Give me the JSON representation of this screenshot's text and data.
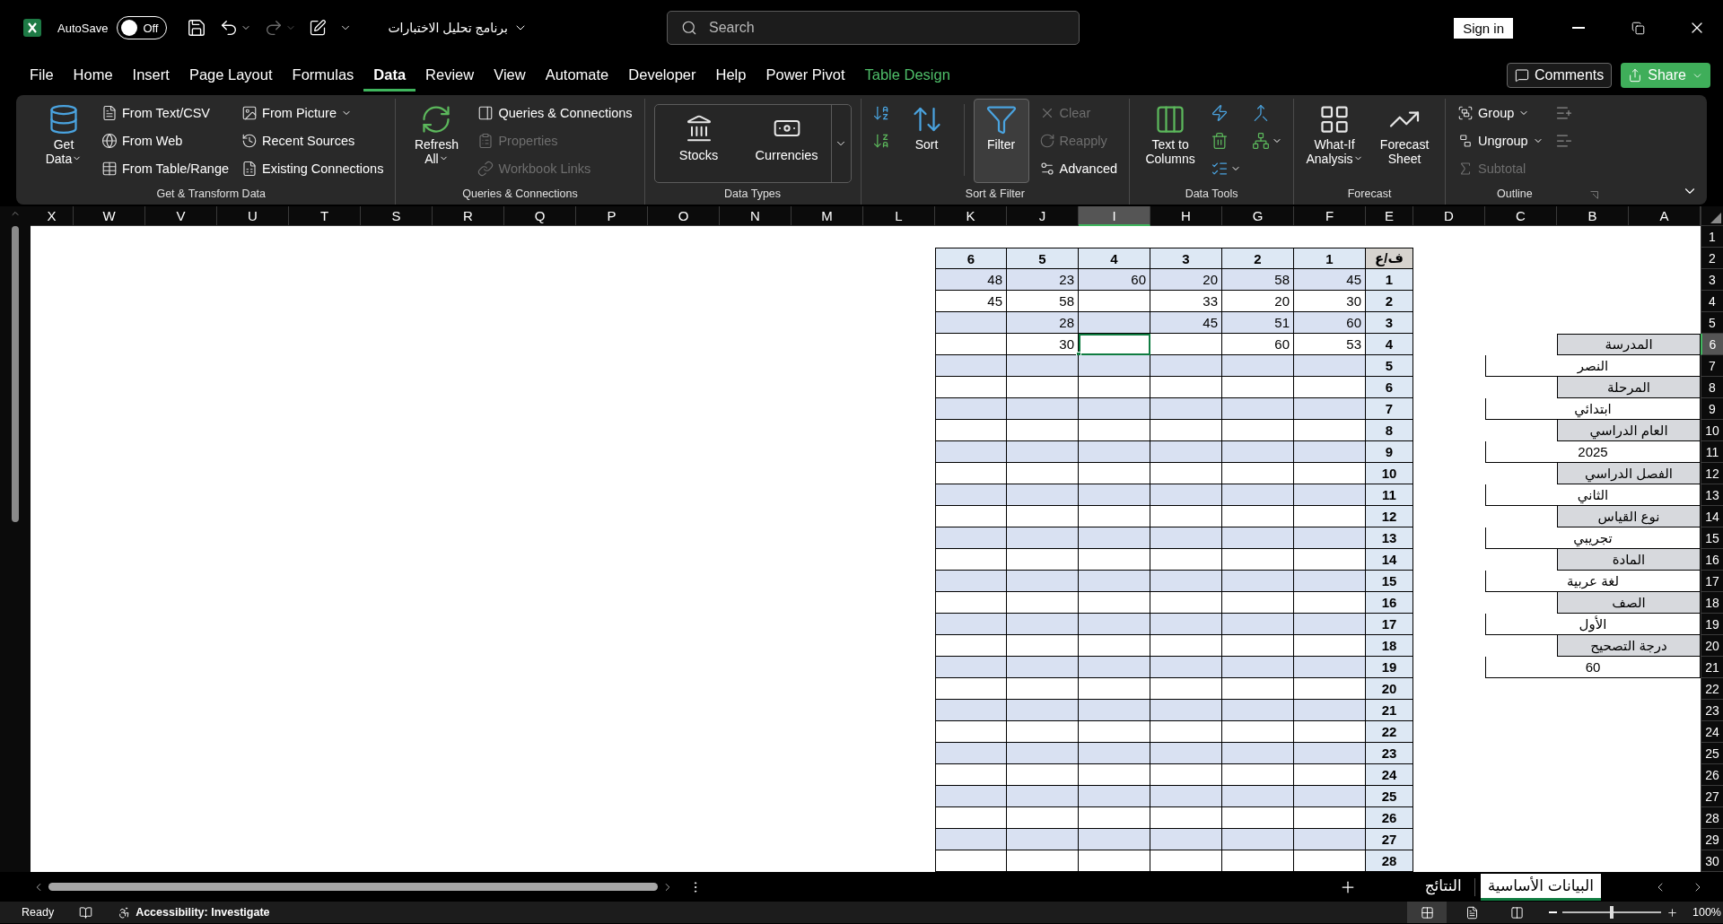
{
  "title_bar": {
    "autosave": {
      "label": "AutoSave",
      "on": false,
      "state_label": "Off"
    },
    "file_title": "برنامج تحليل الاختبارات",
    "search": {
      "placeholder": "Search"
    },
    "sign_in": "Sign in"
  },
  "menu_tabs": [
    {
      "label": "File",
      "selected": false,
      "kind": "normal"
    },
    {
      "label": "Home",
      "selected": false,
      "kind": "normal"
    },
    {
      "label": "Insert",
      "selected": false,
      "kind": "normal"
    },
    {
      "label": "Page Layout",
      "selected": false,
      "kind": "normal"
    },
    {
      "label": "Formulas",
      "selected": false,
      "kind": "normal"
    },
    {
      "label": "Data",
      "selected": true,
      "kind": "normal"
    },
    {
      "label": "Review",
      "selected": false,
      "kind": "normal"
    },
    {
      "label": "View",
      "selected": false,
      "kind": "normal"
    },
    {
      "label": "Automate",
      "selected": false,
      "kind": "normal"
    },
    {
      "label": "Developer",
      "selected": false,
      "kind": "normal"
    },
    {
      "label": "Help",
      "selected": false,
      "kind": "normal"
    },
    {
      "label": "Power Pivot",
      "selected": false,
      "kind": "normal"
    },
    {
      "label": "Table Design",
      "selected": false,
      "kind": "contextual"
    }
  ],
  "comments": "Comments",
  "share": "Share",
  "ribbon": {
    "groups": [
      {
        "label": "Get & Transform Data",
        "columns": [
          {
            "kind": "large",
            "items": [
              {
                "label": "Get Data",
                "dropdown": true
              }
            ]
          },
          {
            "kind": "stack",
            "items": [
              {
                "label": "From Text/CSV",
                "dropdown": false
              },
              {
                "label": "From Web",
                "dropdown": false
              },
              {
                "label": "From Table/Range",
                "dropdown": false
              }
            ]
          },
          {
            "kind": "stack",
            "items": [
              {
                "label": "From Picture",
                "dropdown": true
              },
              {
                "label": "Recent Sources",
                "dropdown": false
              },
              {
                "label": "Existing Connections",
                "dropdown": false
              }
            ]
          }
        ]
      },
      {
        "label": "Queries & Connections",
        "columns": [
          {
            "kind": "large",
            "items": [
              {
                "label": "Refresh All",
                "dropdown": true
              }
            ]
          },
          {
            "kind": "stack",
            "items": [
              {
                "label": "Queries & Connections",
                "disabled": false
              },
              {
                "label": "Properties",
                "disabled": true
              },
              {
                "label": "Workbook Links",
                "disabled": true
              }
            ]
          }
        ]
      },
      {
        "label": "Data Types",
        "columns": [
          {
            "kind": "gallery",
            "items": [
              {
                "label": "Stocks"
              },
              {
                "label": "Currencies"
              }
            ]
          }
        ]
      },
      {
        "label": "Sort & Filter",
        "columns": [
          {
            "kind": "icons",
            "items": [
              {
                "disabled": false
              },
              {
                "disabled": false
              }
            ]
          },
          {
            "kind": "large",
            "items": [
              {
                "label": "Sort",
                "pressed": false
              }
            ]
          },
          {
            "kind": "separator"
          },
          {
            "kind": "large",
            "items": [
              {
                "label": "Filter",
                "pressed": true
              }
            ]
          },
          {
            "kind": "stack",
            "items": [
              {
                "label": "Clear",
                "disabled": true
              },
              {
                "label": "Reapply",
                "disabled": true
              },
              {
                "label": "Advanced",
                "disabled": false
              }
            ]
          }
        ]
      },
      {
        "label": "Data Tools",
        "columns": [
          {
            "kind": "large",
            "items": [
              {
                "label": "Text to Columns"
              }
            ]
          },
          {
            "kind": "icons",
            "items": [
              {
                "dropdown": false
              },
              {
                "dropdown": false
              },
              {
                "dropdown": true
              }
            ]
          },
          {
            "kind": "icons",
            "items": [
              {
                "dropdown": false
              },
              {
                "dropdown": true
              }
            ]
          }
        ]
      },
      {
        "label": "Forecast",
        "columns": [
          {
            "kind": "large",
            "items": [
              {
                "label": "What-If Analysis",
                "dropdown": true
              }
            ]
          },
          {
            "kind": "large",
            "items": [
              {
                "label": "Forecast Sheet",
                "dropdown": false
              }
            ]
          }
        ]
      },
      {
        "label": "Outline",
        "columns": [
          {
            "kind": "stack",
            "items": [
              {
                "label": "Group",
                "dropdown": true,
                "disabled": false
              },
              {
                "label": "Ungroup",
                "dropdown": true,
                "disabled": false
              },
              {
                "label": "Subtotal",
                "dropdown": false,
                "disabled": true
              }
            ]
          },
          {
            "kind": "icons",
            "items": [
              {
                "disabled": true
              },
              {
                "disabled": true
              }
            ]
          }
        ]
      }
    ]
  },
  "sheet": {
    "columns": [
      {
        "label": "X",
        "selected": false
      },
      {
        "label": "W",
        "selected": false
      },
      {
        "label": "V",
        "selected": false
      },
      {
        "label": "U",
        "selected": false
      },
      {
        "label": "T",
        "selected": false
      },
      {
        "label": "S",
        "selected": false
      },
      {
        "label": "R",
        "selected": false
      },
      {
        "label": "Q",
        "selected": false
      },
      {
        "label": "P",
        "selected": false
      },
      {
        "label": "O",
        "selected": false
      },
      {
        "label": "N",
        "selected": false
      },
      {
        "label": "M",
        "selected": false
      },
      {
        "label": "L",
        "selected": false
      },
      {
        "label": "K",
        "selected": false
      },
      {
        "label": "J",
        "selected": false
      },
      {
        "label": "I",
        "selected": true
      },
      {
        "label": "H",
        "selected": false
      },
      {
        "label": "G",
        "selected": false
      },
      {
        "label": "F",
        "selected": false
      },
      {
        "label": "E",
        "selected": false
      },
      {
        "label": "D",
        "selected": false
      },
      {
        "label": "C",
        "selected": false
      },
      {
        "label": "B",
        "selected": false
      },
      {
        "label": "A",
        "selected": false
      }
    ],
    "rows": [
      {
        "label": "1",
        "selected": false
      },
      {
        "label": "2",
        "selected": false
      },
      {
        "label": "3",
        "selected": false
      },
      {
        "label": "4",
        "selected": false
      },
      {
        "label": "5",
        "selected": false
      },
      {
        "label": "6",
        "selected": true
      },
      {
        "label": "7",
        "selected": false
      },
      {
        "label": "8",
        "selected": false
      },
      {
        "label": "9",
        "selected": false
      },
      {
        "label": "10",
        "selected": false
      },
      {
        "label": "11",
        "selected": false
      },
      {
        "label": "12",
        "selected": false
      },
      {
        "label": "13",
        "selected": false
      },
      {
        "label": "14",
        "selected": false
      },
      {
        "label": "15",
        "selected": false
      },
      {
        "label": "16",
        "selected": false
      },
      {
        "label": "17",
        "selected": false
      },
      {
        "label": "18",
        "selected": false
      },
      {
        "label": "19",
        "selected": false
      },
      {
        "label": "20",
        "selected": false
      },
      {
        "label": "21",
        "selected": false
      },
      {
        "label": "22",
        "selected": false
      },
      {
        "label": "23",
        "selected": false
      },
      {
        "label": "24",
        "selected": false
      },
      {
        "label": "25",
        "selected": false
      },
      {
        "label": "26",
        "selected": false
      },
      {
        "label": "27",
        "selected": false
      },
      {
        "label": "28",
        "selected": false
      },
      {
        "label": "29",
        "selected": false
      },
      {
        "label": "30",
        "selected": false
      }
    ],
    "table": {
      "columns": [
        "6",
        "5",
        "4",
        "3",
        "2",
        "1",
        "ف/ع"
      ],
      "rows": [
        {
          "number": "1",
          "cells": [
            {
              "value": "48"
            },
            {
              "value": "23"
            },
            {
              "value": "60"
            },
            {
              "value": "20"
            },
            {
              "value": "58"
            },
            {
              "value": "45"
            }
          ]
        },
        {
          "number": "2",
          "cells": [
            {
              "value": "45"
            },
            {
              "value": "58"
            },
            {},
            {
              "value": "33"
            },
            {
              "value": "20"
            },
            {
              "value": "30"
            }
          ]
        },
        {
          "number": "3",
          "cells": [
            {},
            {
              "value": "28"
            },
            {},
            {
              "value": "45"
            },
            {
              "value": "51"
            },
            {
              "value": "60"
            }
          ]
        },
        {
          "number": "4",
          "cells": [
            {},
            {
              "value": "30"
            },
            {},
            {},
            {
              "value": "60"
            },
            {
              "value": "53"
            }
          ]
        },
        {
          "number": "5"
        },
        {
          "number": "6"
        },
        {
          "number": "7"
        },
        {
          "number": "8"
        },
        {
          "number": "9"
        },
        {
          "number": "10"
        },
        {
          "number": "11"
        },
        {
          "number": "12"
        },
        {
          "number": "13"
        },
        {
          "number": "14"
        },
        {
          "number": "15"
        },
        {
          "number": "16"
        },
        {
          "number": "17"
        },
        {
          "number": "18"
        },
        {
          "number": "19"
        },
        {
          "number": "20"
        },
        {
          "number": "21"
        },
        {
          "number": "22"
        },
        {
          "number": "23"
        },
        {
          "number": "24"
        },
        {
          "number": "25"
        },
        {
          "number": "26"
        },
        {
          "number": "27"
        },
        {
          "number": "28"
        }
      ]
    },
    "info": [
      {
        "label": "المدرسة",
        "value": "النصر"
      },
      {
        "label": "المرحلة",
        "value": "ابتدائي"
      },
      {
        "label": "العام الدراسي",
        "value": "2025"
      },
      {
        "label": "الفصل الدراسي",
        "value": "الثاني"
      },
      {
        "label": "نوع القياس",
        "value": "تجريبي"
      },
      {
        "label": "المادة",
        "value": "لغة عربية"
      },
      {
        "label": "الصف",
        "value": "الأول"
      },
      {
        "label": "درجة التصحيح",
        "value": "60"
      }
    ]
  },
  "sheet_tabs": [
    {
      "label": "البيانات الأساسية",
      "selected": true
    },
    {
      "label": "النتائج",
      "selected": false
    }
  ],
  "status_bar": {
    "ready": "Ready",
    "accessibility": "Accessibility: Investigate",
    "view_buttons": [
      {
        "selected": true
      },
      {
        "selected": false
      },
      {
        "selected": false
      }
    ],
    "zoom_slider": {
      "level": 0.5
    },
    "zoom": "100%"
  }
}
